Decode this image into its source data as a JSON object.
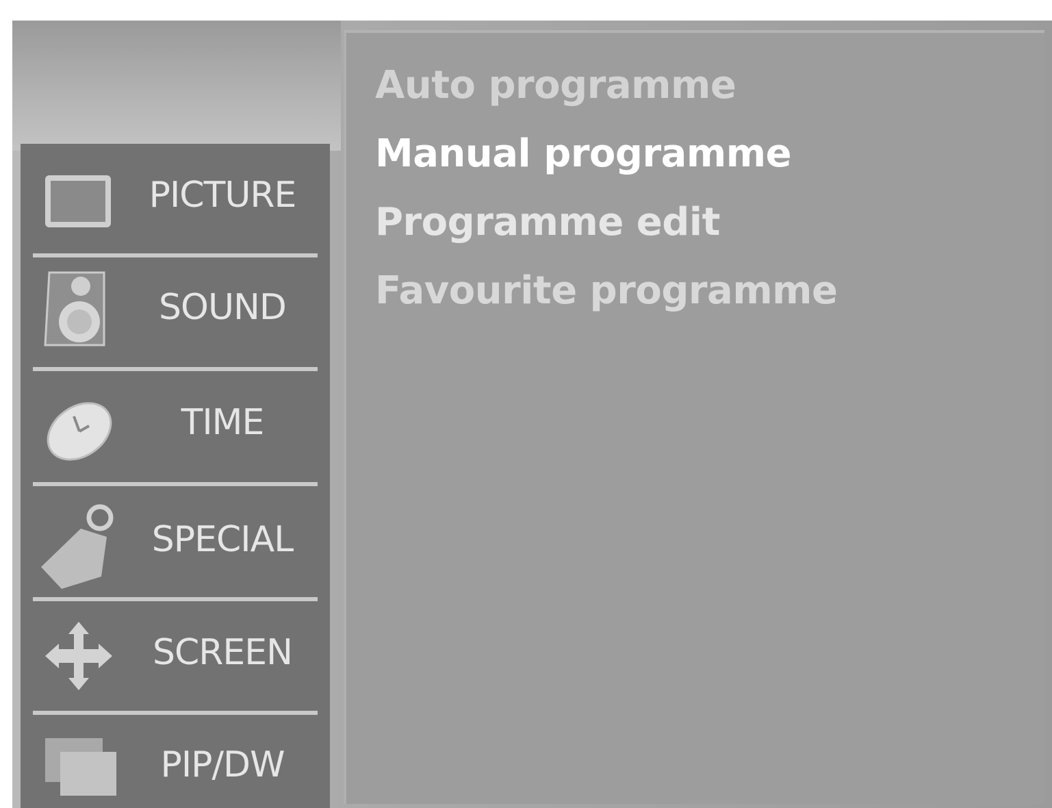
{
  "sidebar": {
    "items": [
      {
        "label": "PICTURE",
        "icon": "picture-icon"
      },
      {
        "label": "SOUND",
        "icon": "speaker-icon"
      },
      {
        "label": "TIME",
        "icon": "clock-icon"
      },
      {
        "label": "SPECIAL",
        "icon": "tag-icon"
      },
      {
        "label": "SCREEN",
        "icon": "move-arrows-icon"
      },
      {
        "label": "PIP/DW",
        "icon": "pip-icon"
      }
    ]
  },
  "menu": {
    "items": [
      {
        "label": "Auto programme",
        "state": "normal"
      },
      {
        "label": "Manual programme",
        "state": "highlighted"
      },
      {
        "label": "Programme edit",
        "state": "normal"
      },
      {
        "label": "Favourite programme",
        "state": "normal"
      }
    ]
  },
  "colors": {
    "sidebar_bg": "#727272",
    "content_bg": "#9d9d9d",
    "highlight_text": "#ffffff",
    "normal_text": "#d8d8d8"
  }
}
